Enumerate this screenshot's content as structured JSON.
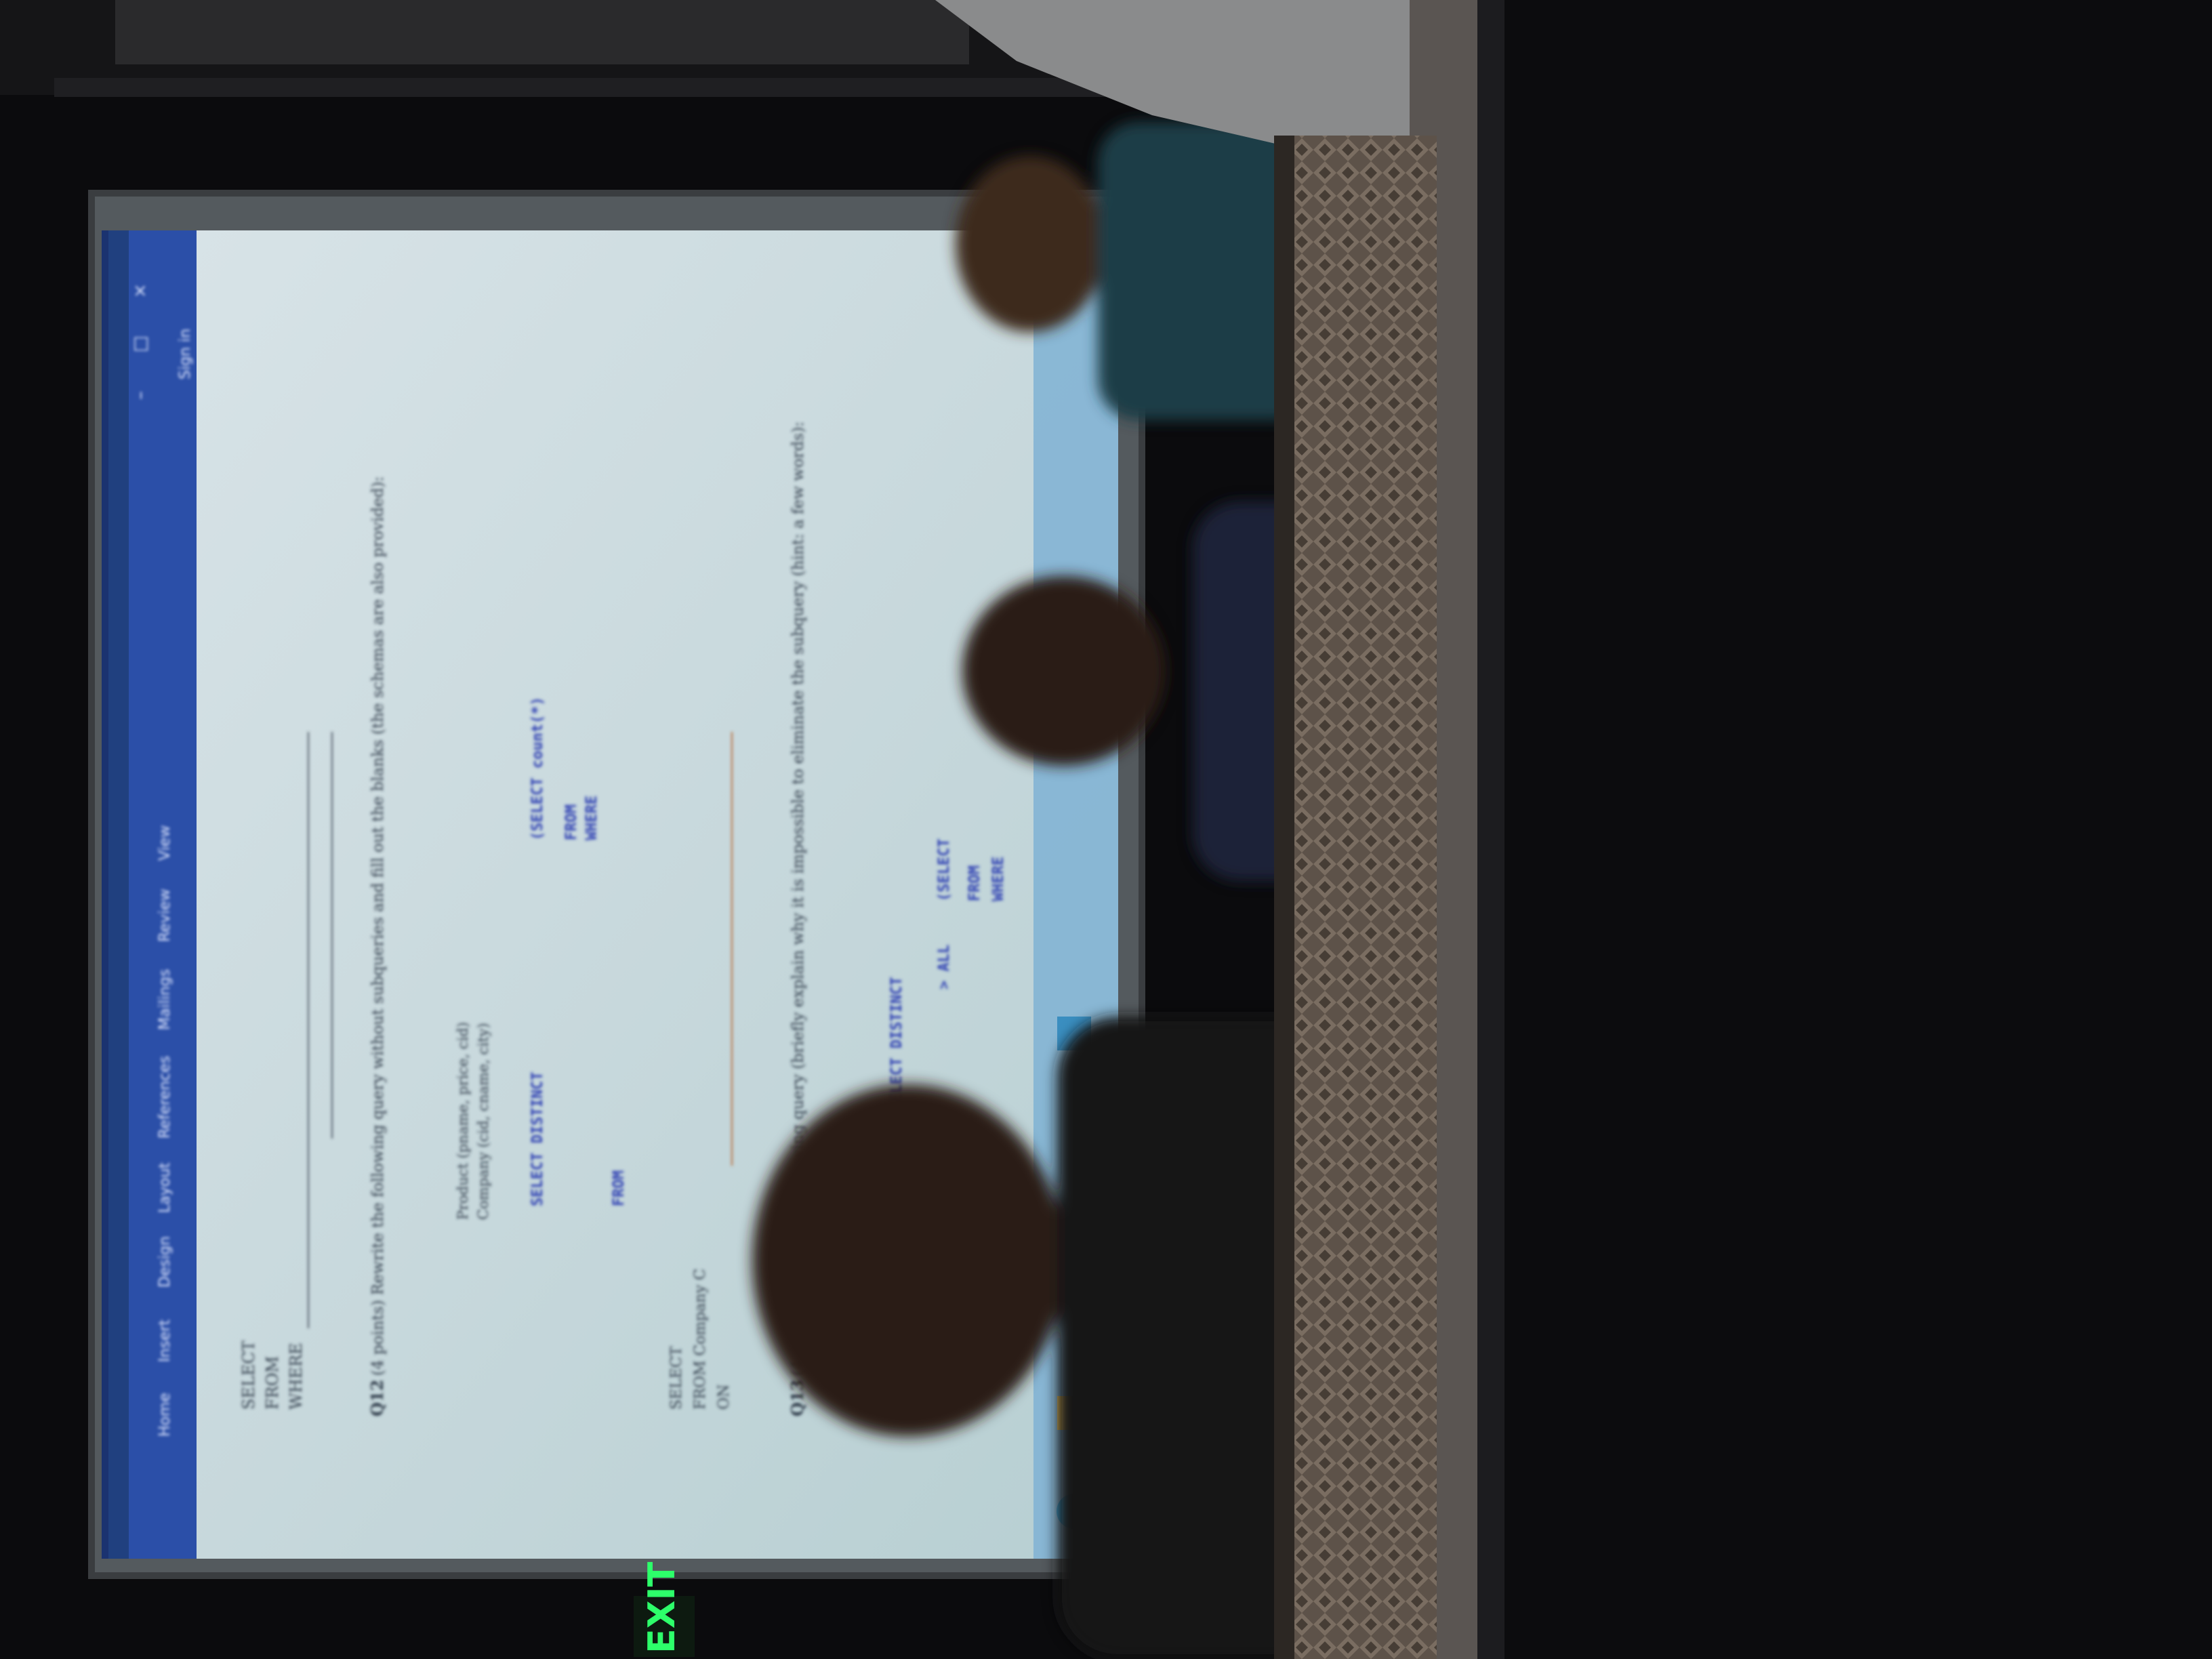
{
  "scene": {
    "palette": {
      "room_dark": "#0b0b0d",
      "projection_bg": "#c9d8dc",
      "ribbon_blue": "#2b4fa8",
      "code_blue": "#2d3fb3",
      "text_gray": "#2f3a4a",
      "seat_fabric": "#5a4f45",
      "exit_green": "#2dff6a"
    }
  },
  "projection": {
    "ribbon": {
      "tabs": [
        "Home",
        "Insert",
        "Design",
        "Layout",
        "References",
        "Mailings",
        "Review",
        "View"
      ],
      "sign_in": "Sign in"
    },
    "document": {
      "query1": {
        "line1": "SELECT",
        "line2": "FROM",
        "line3": "WHERE"
      },
      "q12_label": "Q12",
      "q12_text": "(4 points) Rewrite the following query without subqueries and fill out the blanks (the schemas are also provided):",
      "schema": {
        "product": "Product (pname, price, cid)",
        "company": "Company (cid, cname, city)"
      },
      "code1": {
        "select": "SELECT DISTINCT",
        "from": "FROM",
        "inner_select": "(SELECT count(*)",
        "inner_from": "FROM",
        "inner_where": "WHERE"
      },
      "query2": {
        "line1": "SELECT",
        "line2": "FROM Company C",
        "line3": "ON"
      },
      "q13_label": "Q13",
      "q13_text": "(4 points) Rewrite the following query (briefly explain why it is impossible to eliminate the subquery (hint: a few words):",
      "code2": {
        "select": "SELECT DISTINCT",
        "all": "> ALL",
        "select2": "(SELECT",
        "from": "FROM",
        "where": "WHERE"
      }
    }
  },
  "room": {
    "exit_sign": "EXIT"
  }
}
